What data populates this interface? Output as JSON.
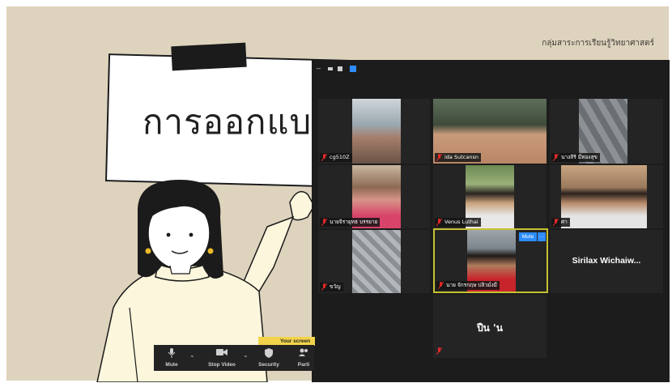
{
  "slide": {
    "header": "กลุ่มสาระการเรียนรู้วิทยาศาสตร์",
    "board_text": "การออกแบบ"
  },
  "zoom": {
    "participants": [
      {
        "name": "cg510Z",
        "video": true
      },
      {
        "name": "ida Sutcansn",
        "video": true
      },
      {
        "name": "นางสิริ มีทองสุข",
        "video": true
      },
      {
        "name": "นายจิรายุทธ บรรยาย",
        "video": true
      },
      {
        "name": "Venus Luthai",
        "video": true
      },
      {
        "name": "ศา",
        "video": true
      },
      {
        "name": "ขวัญ",
        "video": true
      },
      {
        "name": "นาย จักรกฤษ ปลิวมั่งมี",
        "video": true,
        "active": true
      },
      {
        "name": "Sirilax Wichaiw...",
        "video": false
      },
      {
        "name": "ปืน 'น",
        "video": false
      }
    ],
    "tile_controls": {
      "mute_label": "Mute",
      "more_label": "···"
    }
  },
  "toolbar": {
    "banner": "Your screen",
    "items": [
      {
        "label": "Mute",
        "icon": "mic-icon"
      },
      {
        "label": "Stop Video",
        "icon": "video-camera-icon"
      },
      {
        "label": "Security",
        "icon": "shield-icon"
      },
      {
        "label": "Parti",
        "icon": "participants-icon"
      }
    ]
  },
  "colors": {
    "slide_bg": "#ded3bd",
    "panel_bg": "#1c1c1c",
    "active_border": "#c7c032",
    "button_blue": "#2d8cff",
    "mic_off_red": "#e02828"
  }
}
